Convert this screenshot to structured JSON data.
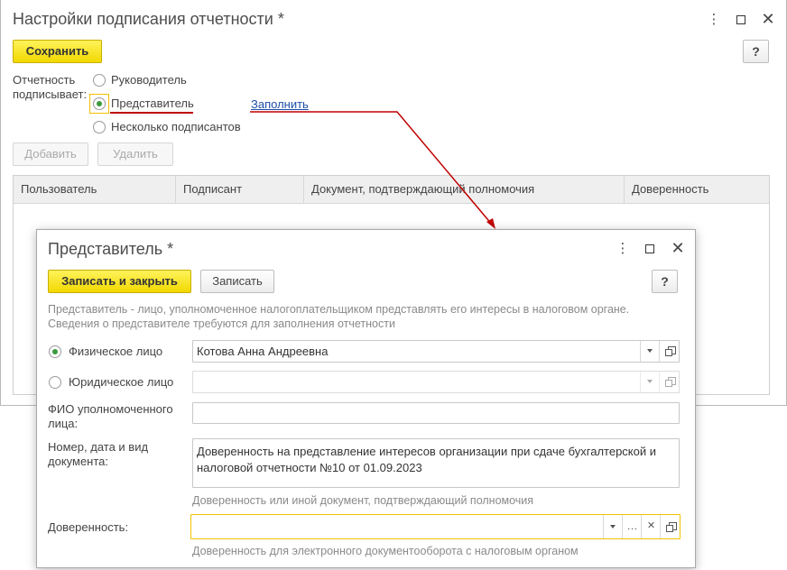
{
  "outer": {
    "title": "Настройки подписания отчетности *",
    "save_label": "Сохранить",
    "help_label": "?",
    "signer_label_line1": "Отчетность",
    "signer_label_line2": "подписывает:",
    "options": [
      "Руководитель",
      "Представитель",
      "Несколько подписантов"
    ],
    "selected_option": "Представитель",
    "fill_link": "Заполнить",
    "add_label": "Добавить",
    "delete_label": "Удалить",
    "table_columns": [
      "Пользователь",
      "Подписант",
      "Документ, подтверждающий полномочия",
      "Доверенность"
    ]
  },
  "dialog": {
    "title": "Представитель *",
    "write_close_label": "Записать и закрыть",
    "write_label": "Записать",
    "help_label": "?",
    "info_line1": "Представитель - лицо, уполномоченное налогоплательщиком представлять его интересы в налоговом органе.",
    "info_line2": "Сведения о представителе требуются для заполнения отчетности",
    "radio_individual": "Физическое лицо",
    "radio_legal": "Юридическое лицо",
    "individual_value": "Котова Анна Андреевна",
    "legal_value": "",
    "fio_label_line1": "ФИО уполномоченного",
    "fio_label_line2": "лица:",
    "fio_value": "",
    "doc_label_line1": "Номер, дата и вид",
    "doc_label_line2": "документа:",
    "doc_value_line1": "Доверенность на представление интересов организации при сдаче бухгалтерской и",
    "doc_value_line2": "налоговой отчетности №10 от 01.09.2023",
    "doc_hint": "Доверенность или иной документ, подтверждающий полномочия",
    "power_label": "Доверенность:",
    "power_value": "",
    "power_hint": "Доверенность для электронного документооборота с налоговым органом"
  },
  "colors": {
    "accent_yellow": "#f5dc00",
    "radio_green": "#3b9a3b",
    "annotation_red": "#c00000",
    "link_blue": "#1f4fa8"
  }
}
